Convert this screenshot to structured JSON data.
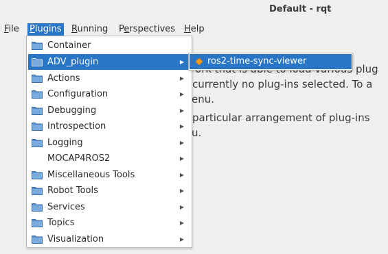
{
  "window": {
    "title": "Default - rqt"
  },
  "menubar": {
    "items": [
      {
        "label": "File",
        "mnemonic": "F",
        "rest": "ile"
      },
      {
        "label": "Plugins",
        "mnemonic": "P",
        "rest": "lugins"
      },
      {
        "label": "Running",
        "mnemonic": "R",
        "rest": "unning"
      },
      {
        "label": "Perspectives",
        "pre": "P",
        "mnemonic": "e",
        "rest": "rspectives"
      },
      {
        "label": "Help",
        "mnemonic": "H",
        "rest": "elp"
      }
    ]
  },
  "plugins_menu": {
    "items": [
      {
        "label": "Container",
        "icon": "folder-icon",
        "submenu": false
      },
      {
        "label": "ADV_plugin",
        "icon": "folder-icon",
        "submenu": true,
        "selected": true
      },
      {
        "label": "Actions",
        "icon": "folder-icon",
        "submenu": true
      },
      {
        "label": "Configuration",
        "icon": "folder-icon",
        "submenu": true
      },
      {
        "label": "Debugging",
        "icon": "folder-icon",
        "submenu": true
      },
      {
        "label": "Introspection",
        "icon": "folder-icon",
        "submenu": true
      },
      {
        "label": "Logging",
        "icon": "folder-icon",
        "submenu": true
      },
      {
        "label": "MOCAP4ROS2",
        "icon": "",
        "submenu": true
      },
      {
        "label": "Miscellaneous Tools",
        "icon": "folder-icon",
        "submenu": true
      },
      {
        "label": "Robot Tools",
        "icon": "folder-icon",
        "submenu": true
      },
      {
        "label": "Services",
        "icon": "folder-icon",
        "submenu": true
      },
      {
        "label": "Topics",
        "icon": "folder-icon",
        "submenu": true
      },
      {
        "label": "Visualization",
        "icon": "folder-icon",
        "submenu": true
      }
    ]
  },
  "adv_submenu": {
    "items": [
      {
        "label": "ros2-time-sync-viewer",
        "icon": "diamond-icon"
      }
    ]
  },
  "background_text": {
    "line1": "ork that is able to load various plug",
    "line2": "currently no plug-ins selected. To a",
    "line3": "enu.",
    "line4": "particular arrangement of plug-ins",
    "line5": "u."
  },
  "colors": {
    "accent": "#2a76c6",
    "background": "#f0efee",
    "folder": "#5a8fc8"
  }
}
